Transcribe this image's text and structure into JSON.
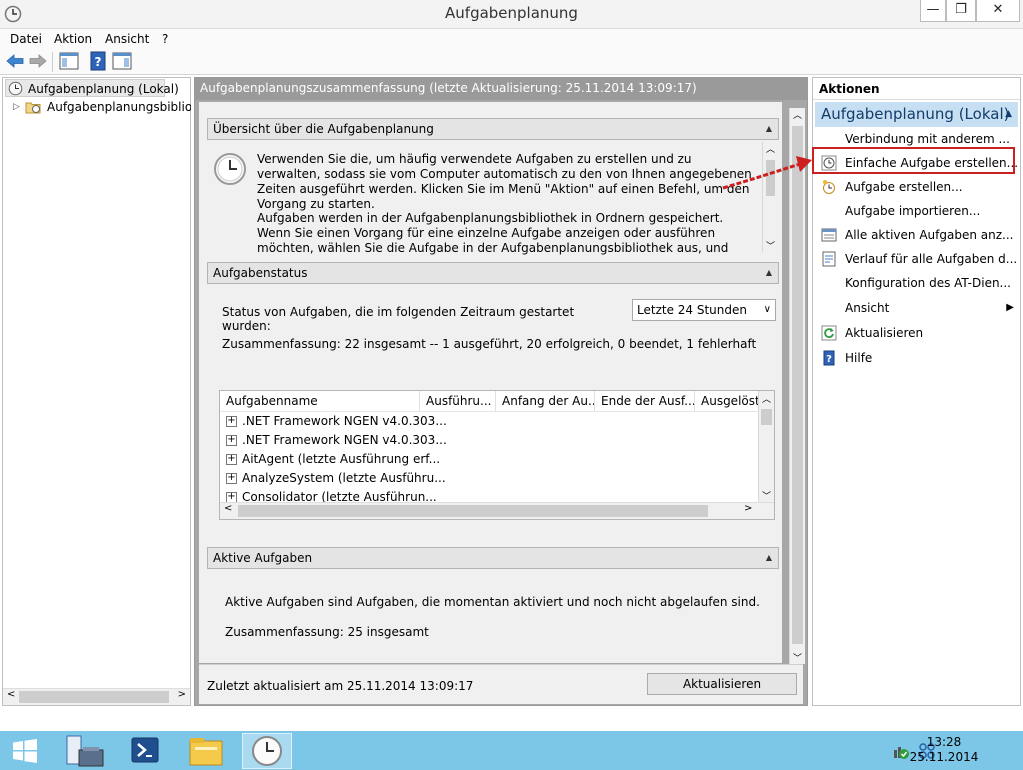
{
  "window": {
    "title": "Aufgabenplanung",
    "min": "—",
    "max": "❐",
    "close": "✕"
  },
  "menu": [
    "Datei",
    "Aktion",
    "Ansicht",
    "?"
  ],
  "tree": {
    "root": "Aufgabenplanung (Lokal)",
    "child": "Aufgabenplanungsbibliothek"
  },
  "main": {
    "header": "Aufgabenplanungszusammenfassung (letzte Aktualisierung: 25.11.2014 13:09:17)",
    "overview": {
      "title": "Übersicht über die Aufgabenplanung",
      "para1": "Verwenden Sie die, um häufig verwendete Aufgaben zu erstellen und zu verwalten, sodass sie vom Computer automatisch zu den von Ihnen angegebenen Zeiten ausgeführt werden. Klicken Sie im Menü \"Aktion\" auf einen Befehl, um den Vorgang zu starten.",
      "para2": "Aufgaben werden in der Aufgabenplanungsbibliothek in Ordnern gespeichert. Wenn Sie einen Vorgang für eine einzelne Aufgabe anzeigen oder ausführen möchten, wählen Sie die Aufgabe in der Aufgabenplanungsbibliothek aus, und klicken Sie im Menü \"Aktion\" auf einen"
    },
    "status": {
      "title": "Aufgabenstatus",
      "label": "Status von Aufgaben, die im folgenden Zeitraum gestartet wurden:",
      "period": "Letzte 24 Stunden",
      "summary": "Zusammenfassung: 22 insgesamt -- 1 ausgeführt, 20 erfolgreich, 0 beendet, 1 fehlerhaft",
      "columns": [
        "Aufgabenname",
        "Ausführu...",
        "Anfang der Au...",
        "Ende der Ausf...",
        "Ausgelöst"
      ],
      "rows": [
        ".NET Framework NGEN v4.0.303...",
        ".NET Framework NGEN v4.0.303...",
        "AitAgent (letzte Ausführung erf...",
        "AnalyzeSystem (letzte Ausführu...",
        "Consolidator (letzte Ausführun..."
      ]
    },
    "active": {
      "title": "Aktive Aufgaben",
      "text": "Aktive Aufgaben sind Aufgaben, die momentan aktiviert und noch nicht abgelaufen sind.",
      "summary": "Zusammenfassung: 25 insgesamt"
    },
    "footer": {
      "last_update": "Zuletzt aktualisiert am 25.11.2014 13:09:17",
      "refresh_button": "Aktualisieren"
    }
  },
  "actions": {
    "title": "Aktionen",
    "subtitle": "Aufgabenplanung (Lokal)",
    "items": [
      "Verbindung mit anderem ...",
      "Einfache Aufgabe erstellen...",
      "Aufgabe erstellen...",
      "Aufgabe importieren...",
      "Alle aktiven Aufgaben anz...",
      "Verlauf für alle Aufgaben d...",
      "Konfiguration des AT-Dien...",
      "Ansicht",
      "Aktualisieren",
      "Hilfe"
    ]
  },
  "taskbar": {
    "time": "13:28",
    "date": "25.11.2014"
  },
  "colors": {
    "accent": "#c7dff3",
    "taskbar": "#7cc7e8",
    "annotation": "#cc2020"
  }
}
